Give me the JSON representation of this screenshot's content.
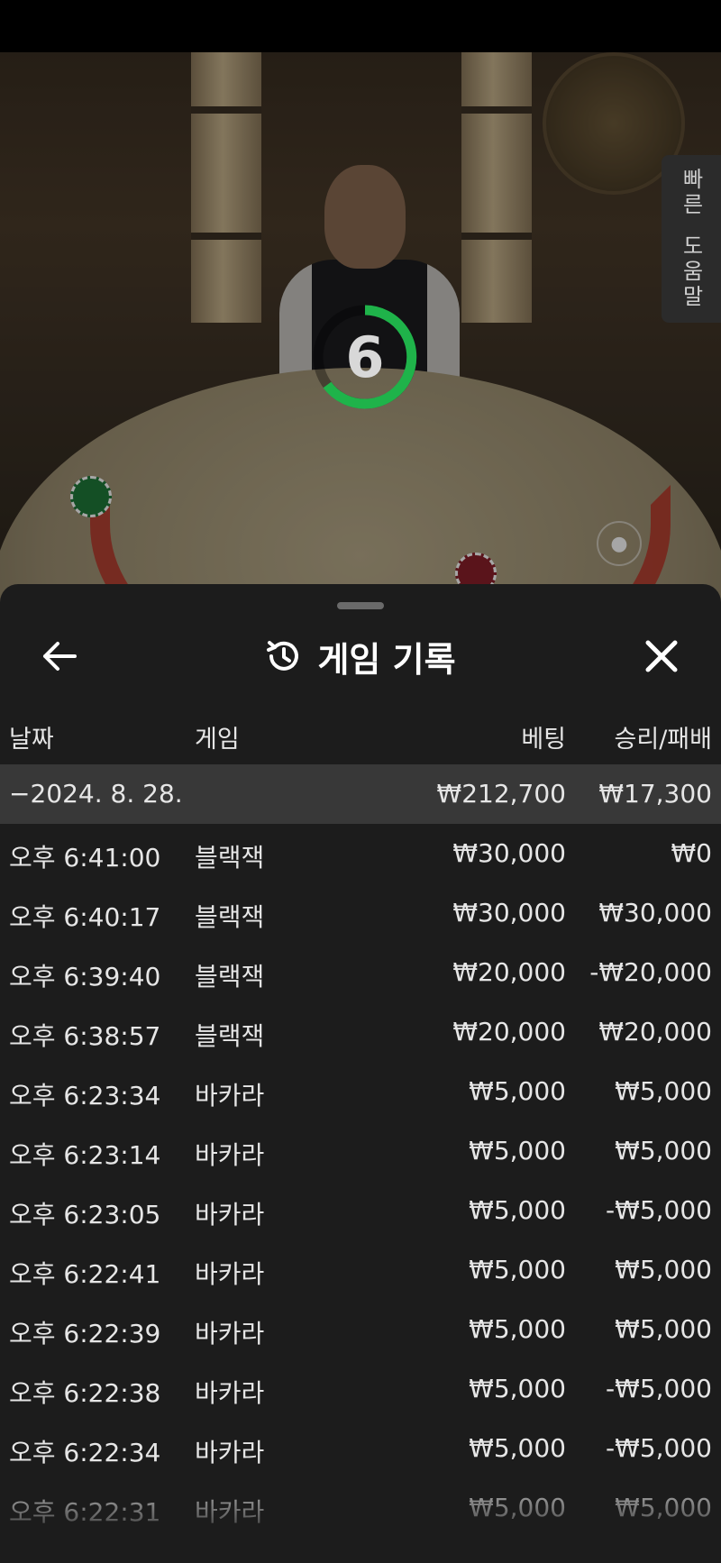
{
  "game_view": {
    "countdown": "6",
    "help_tab": [
      "빠른",
      "도움말"
    ]
  },
  "history": {
    "title": "게임 기록",
    "columns": {
      "date": "날짜",
      "game": "게임",
      "bet": "베팅",
      "result": "승리/패배"
    },
    "summary": {
      "date": "−2024. 8. 28.",
      "bet": "₩212,700",
      "result": "₩17,300"
    },
    "rows": [
      {
        "time": "오후 6:41:00",
        "game": "블랙잭",
        "bet": "₩30,000",
        "result": "₩0"
      },
      {
        "time": "오후 6:40:17",
        "game": "블랙잭",
        "bet": "₩30,000",
        "result": "₩30,000"
      },
      {
        "time": "오후 6:39:40",
        "game": "블랙잭",
        "bet": "₩20,000",
        "result": "-₩20,000"
      },
      {
        "time": "오후 6:38:57",
        "game": "블랙잭",
        "bet": "₩20,000",
        "result": "₩20,000"
      },
      {
        "time": "오후 6:23:34",
        "game": "바카라",
        "bet": "₩5,000",
        "result": "₩5,000"
      },
      {
        "time": "오후 6:23:14",
        "game": "바카라",
        "bet": "₩5,000",
        "result": "₩5,000"
      },
      {
        "time": "오후 6:23:05",
        "game": "바카라",
        "bet": "₩5,000",
        "result": "-₩5,000"
      },
      {
        "time": "오후 6:22:41",
        "game": "바카라",
        "bet": "₩5,000",
        "result": "₩5,000"
      },
      {
        "time": "오후 6:22:39",
        "game": "바카라",
        "bet": "₩5,000",
        "result": "₩5,000"
      },
      {
        "time": "오후 6:22:38",
        "game": "바카라",
        "bet": "₩5,000",
        "result": "-₩5,000"
      },
      {
        "time": "오후 6:22:34",
        "game": "바카라",
        "bet": "₩5,000",
        "result": "-₩5,000"
      },
      {
        "time": "오후 6:22:31",
        "game": "바카라",
        "bet": "₩5,000",
        "result": "₩5,000"
      }
    ]
  },
  "icons": {
    "back": "arrow-left",
    "history": "history-clock",
    "close": "close-x"
  }
}
